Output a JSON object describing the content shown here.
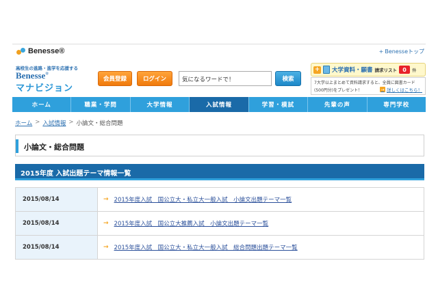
{
  "topbar": {
    "logo_text": "Benesse",
    "logo_reg": "®",
    "benesse_top_arrow": "+",
    "benesse_top_label": "Benesseトップ"
  },
  "header": {
    "tagline": "高校生の進路・進学を応援する",
    "brand_line1": "Benesse",
    "brand_line1_reg": "®",
    "brand_line2": "マナビジョン",
    "register_button": "会員登録",
    "login_button": "ログイン",
    "search_value": "気になるワードで！",
    "search_button": "検索"
  },
  "request": {
    "plus": "+",
    "title": "大学資料・願書",
    "list_label": "請求リスト",
    "count": "0",
    "unit": "件",
    "note_line1": "7大学以上まとめて資料請求すると、全員に図書カード",
    "note_line2": "(500円分)をプレゼント！",
    "detail_icon": "→",
    "detail_link": "詳しくはこちら！"
  },
  "nav": {
    "items": [
      {
        "label": "ホーム",
        "active": false
      },
      {
        "label": "職業・学問",
        "active": false
      },
      {
        "label": "大学情報",
        "active": false
      },
      {
        "label": "入試情報",
        "active": true
      },
      {
        "label": "学習・模試",
        "active": false
      },
      {
        "label": "先輩の声",
        "active": false
      },
      {
        "label": "専門学校",
        "active": false
      }
    ]
  },
  "breadcrumb": {
    "home": "ホーム",
    "sep": ">",
    "exam_info": "入試情報",
    "current": "小論文・総合問題"
  },
  "page": {
    "title": "小論文・総合問題",
    "section_title": "2015年度 入試出題テーマ情報一覧"
  },
  "rows": [
    {
      "date": "2015/08/14",
      "arrow": "→",
      "link": "2015年度入試　国公立大・私立大一般入試　小論文出題テーマ一覧"
    },
    {
      "date": "2015/08/14",
      "arrow": "→",
      "link": "2015年度入試　国公立大推薦入試　小論文出題テーマ一覧"
    },
    {
      "date": "2015/08/14",
      "arrow": "→",
      "link": "2015年度入試　国公立大・私立大一般入試　総合問題出題テーマ一覧"
    }
  ],
  "colors": {
    "nav_bg": "#2fa0dc",
    "nav_active": "#1a6aa8",
    "orange_button": "#f07a0c",
    "count_badge": "#e8222a"
  }
}
